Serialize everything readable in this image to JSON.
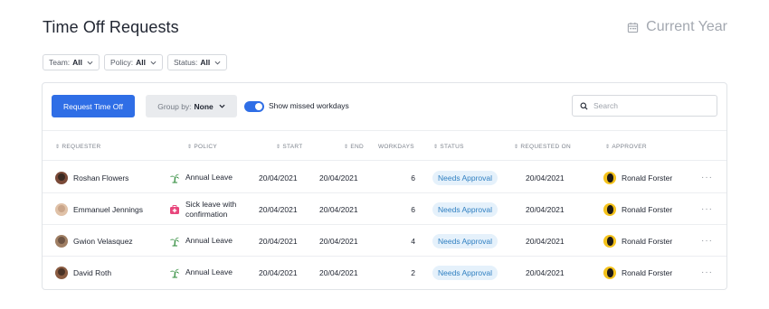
{
  "page": {
    "title": "Time Off Requests",
    "year_label": "Current Year",
    "year_icon": "calendar-icon"
  },
  "filters": [
    {
      "label": "Team:",
      "value": "All"
    },
    {
      "label": "Policy:",
      "value": "All"
    },
    {
      "label": "Status:",
      "value": "All"
    }
  ],
  "toolbar": {
    "request_label": "Request Time Off",
    "group_by_label": "Group by:",
    "group_by_value": "None",
    "toggle_label": "Show missed workdays",
    "toggle_on": true,
    "search_placeholder": "Search"
  },
  "columns": [
    "REQUESTER",
    "POLICY",
    "START",
    "END",
    "WORKDAYS",
    "STATUS",
    "REQUESTED ON",
    "APPROVER"
  ],
  "rows": [
    {
      "requester": "Roshan Flowers",
      "policy": "Annual Leave",
      "policy_icon": "palm-tree-icon",
      "start": "20/04/2021",
      "end": "20/04/2021",
      "workdays": "6",
      "status": "Needs Approval",
      "requested_on": "20/04/2021",
      "approver": "Ronald Forster",
      "more": "···"
    },
    {
      "requester": "Emmanuel Jennings",
      "policy": "Sick leave with confirmation",
      "policy_icon": "medical-kit-icon",
      "start": "20/04/2021",
      "end": "20/04/2021",
      "workdays": "6",
      "status": "Needs Approval",
      "requested_on": "20/04/2021",
      "approver": "Ronald Forster",
      "more": "···"
    },
    {
      "requester": "Gwion Velasquez",
      "policy": "Annual Leave",
      "policy_icon": "palm-tree-icon",
      "start": "20/04/2021",
      "end": "20/04/2021",
      "workdays": "4",
      "status": "Needs Approval",
      "requested_on": "20/04/2021",
      "approver": "Ronald Forster",
      "more": "···"
    },
    {
      "requester": "David Roth",
      "policy": "Annual Leave",
      "policy_icon": "palm-tree-icon",
      "start": "20/04/2021",
      "end": "20/04/2021",
      "workdays": "2",
      "status": "Needs Approval",
      "requested_on": "20/04/2021",
      "approver": "Ronald Forster",
      "more": "···"
    }
  ],
  "colors": {
    "accent": "#2f6ee6",
    "badge_bg": "#e5f1fb",
    "badge_text": "#2f7fc1",
    "palm": "#2e8b3a",
    "medical": "#e8467c"
  }
}
